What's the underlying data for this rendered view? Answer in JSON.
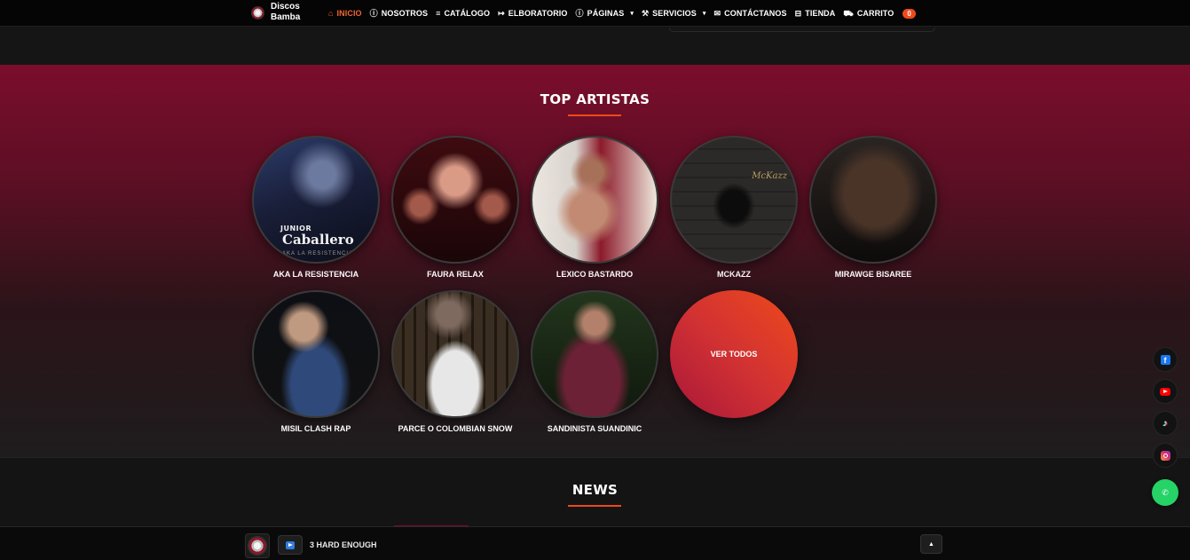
{
  "brand": {
    "name": "Discos Bamba"
  },
  "nav": [
    {
      "icon": "home-icon",
      "glyph": "⌂",
      "label": "INICIO",
      "active": true,
      "dropdown": false
    },
    {
      "icon": "info-icon",
      "glyph": "ⓘ",
      "label": "NOSOTROS",
      "active": false,
      "dropdown": false
    },
    {
      "icon": "list-icon",
      "glyph": "≡",
      "label": "CATÁLOGO",
      "active": false,
      "dropdown": false
    },
    {
      "icon": "arrow-icon",
      "glyph": "↦",
      "label": "ELBORATORIO",
      "active": false,
      "dropdown": false
    },
    {
      "icon": "info-icon",
      "glyph": "ⓘ",
      "label": "PÁGINAS",
      "active": false,
      "dropdown": true
    },
    {
      "icon": "wrench-icon",
      "glyph": "⚒",
      "label": "SERVICIOS",
      "active": false,
      "dropdown": true
    },
    {
      "icon": "mail-icon",
      "glyph": "✉",
      "label": "CONTÁCTANOS",
      "active": false,
      "dropdown": false
    },
    {
      "icon": "store-icon",
      "glyph": "⊟",
      "label": "TIENDA",
      "active": false,
      "dropdown": false
    },
    {
      "icon": "cart-icon",
      "glyph": "⛟",
      "label": "CARRITO",
      "active": false,
      "dropdown": false,
      "badge": "0"
    }
  ],
  "artists_section": {
    "title": "TOP ARTISTAS",
    "artists": [
      {
        "name": "AKA LA RESISTENCIA",
        "photo_text": {
          "line1": "JUNIOR",
          "line2": "Caballero",
          "line3": "AKA LA RESISTENCIA"
        }
      },
      {
        "name": "FAURA RELAX"
      },
      {
        "name": "LEXICO BASTARDO"
      },
      {
        "name": "MCKAZZ",
        "photo_text": {
          "line1": "McKazz"
        }
      },
      {
        "name": "MIRAWGE BISAREE"
      },
      {
        "name": "MISIL CLASH RAP"
      },
      {
        "name": "PARCE O COLOMBIAN SNOW"
      },
      {
        "name": "SANDINISTA SUANDINIC"
      }
    ],
    "see_all_label": "VER TODOS"
  },
  "news_section": {
    "title": "NEWS"
  },
  "player": {
    "track": "3 HARD ENOUGH"
  },
  "social": [
    "facebook-icon",
    "youtube-icon",
    "tiktok-icon",
    "instagram-icon"
  ],
  "colors": {
    "accent": "#ee4a1b",
    "active_nav": "#f06432",
    "section_top": "#7b0d2c",
    "whatsapp": "#25d366"
  }
}
